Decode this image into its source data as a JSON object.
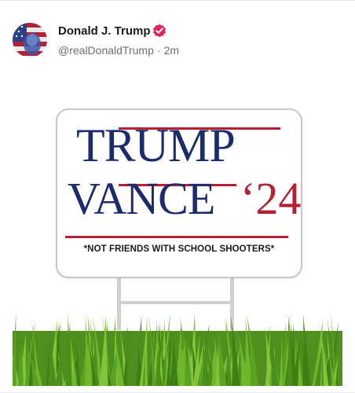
{
  "post": {
    "author_name": "Donald J. Trump",
    "handle": "@realDonaldTrump",
    "separator": "·",
    "timestamp": "2m",
    "verified_badge": "verified-check-icon",
    "verified_color": "#e0245e"
  },
  "image": {
    "sign_line_1": "TRUMP",
    "sign_line_2": "VANCE",
    "sign_year": "‘24",
    "sign_tagline": "*NOT FRIENDS WITH SCHOOL SHOOTERS*",
    "colors": {
      "navy": "#1c2a6e",
      "red": "#b22234"
    }
  }
}
